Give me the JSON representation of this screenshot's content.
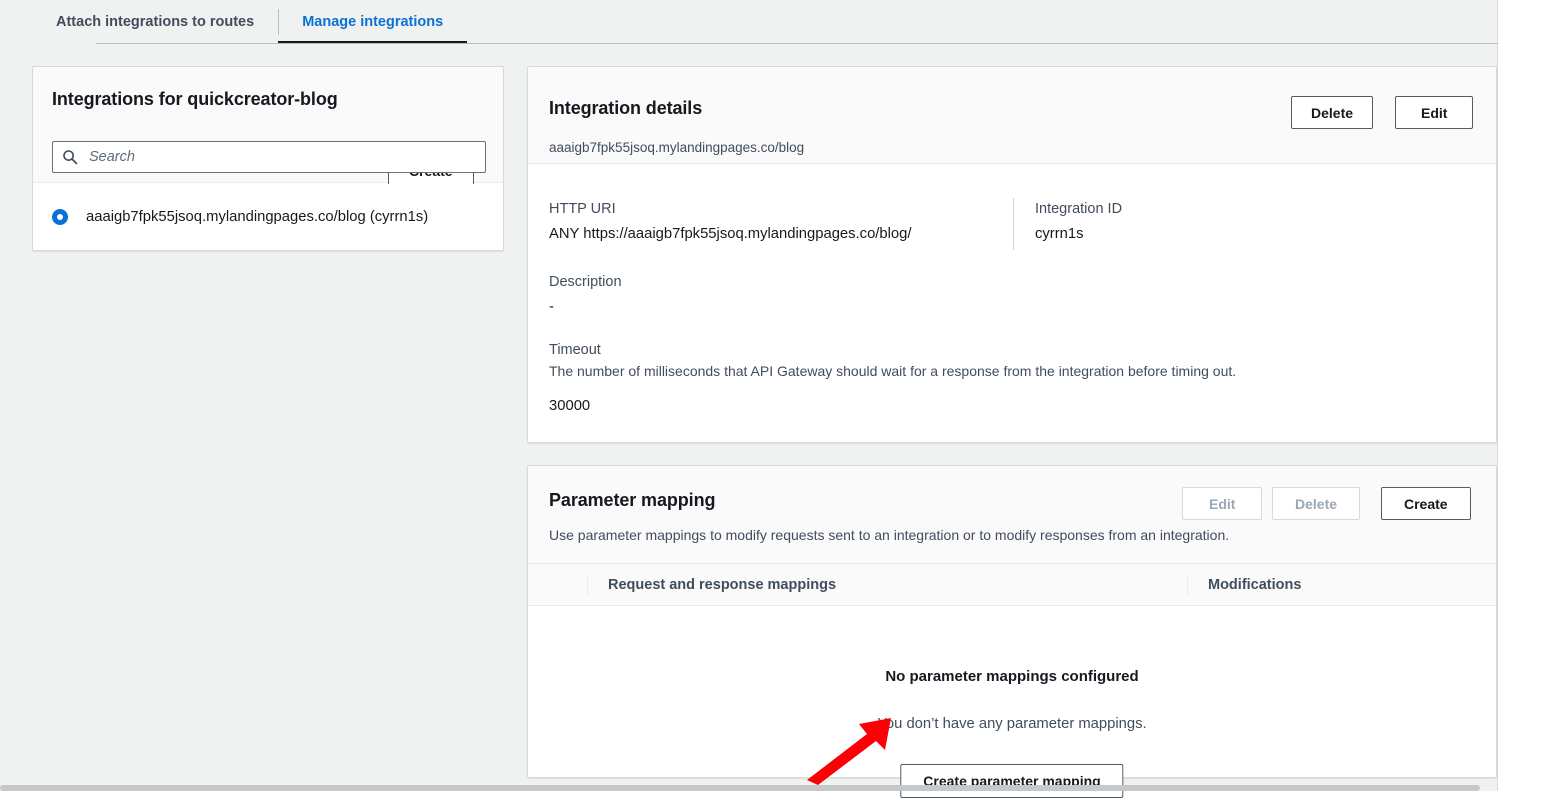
{
  "tabs": [
    {
      "label": "Attach integrations to routes",
      "active": false
    },
    {
      "label": "Manage integrations",
      "active": true
    }
  ],
  "integrations_panel": {
    "title": "Integrations for quickcreator-blog",
    "create_label": "Create",
    "search": {
      "placeholder": "Search",
      "value": "",
      "icon": "search-icon"
    },
    "items": [
      {
        "label": "aaaigb7fpk55jsoq.mylandingpages.co/blog (cyrrn1s)",
        "selected": true
      }
    ]
  },
  "details_panel": {
    "title": "Integration details",
    "subtitle": "aaaigb7fpk55jsoq.mylandingpages.co/blog",
    "delete_label": "Delete",
    "edit_label": "Edit",
    "fields": {
      "http_uri": {
        "label": "HTTP URI",
        "value": "ANY https://aaaigb7fpk55jsoq.mylandingpages.co/blog/"
      },
      "integration_id": {
        "label": "Integration ID",
        "value": "cyrrn1s"
      },
      "description": {
        "label": "Description",
        "value": "-"
      },
      "timeout": {
        "label": "Timeout",
        "description": "The number of milliseconds that API Gateway should wait for a response from the integration before timing out.",
        "value": "30000"
      }
    }
  },
  "parameter_mapping_panel": {
    "title": "Parameter mapping",
    "subtitle": "Use parameter mappings to modify requests sent to an integration or to modify responses from an integration.",
    "edit_label": "Edit",
    "edit_disabled": true,
    "delete_label": "Delete",
    "delete_disabled": true,
    "create_label": "Create",
    "table": {
      "columns": [
        "Request and response mappings",
        "Modifications"
      ],
      "rows": []
    },
    "empty_state": {
      "title": "No parameter mappings configured",
      "text": "You don’t have any parameter mappings.",
      "button_label": "Create parameter mapping"
    }
  },
  "annotation": {
    "type": "arrow",
    "color": "#fb0007",
    "points_to": "Create parameter mapping"
  }
}
